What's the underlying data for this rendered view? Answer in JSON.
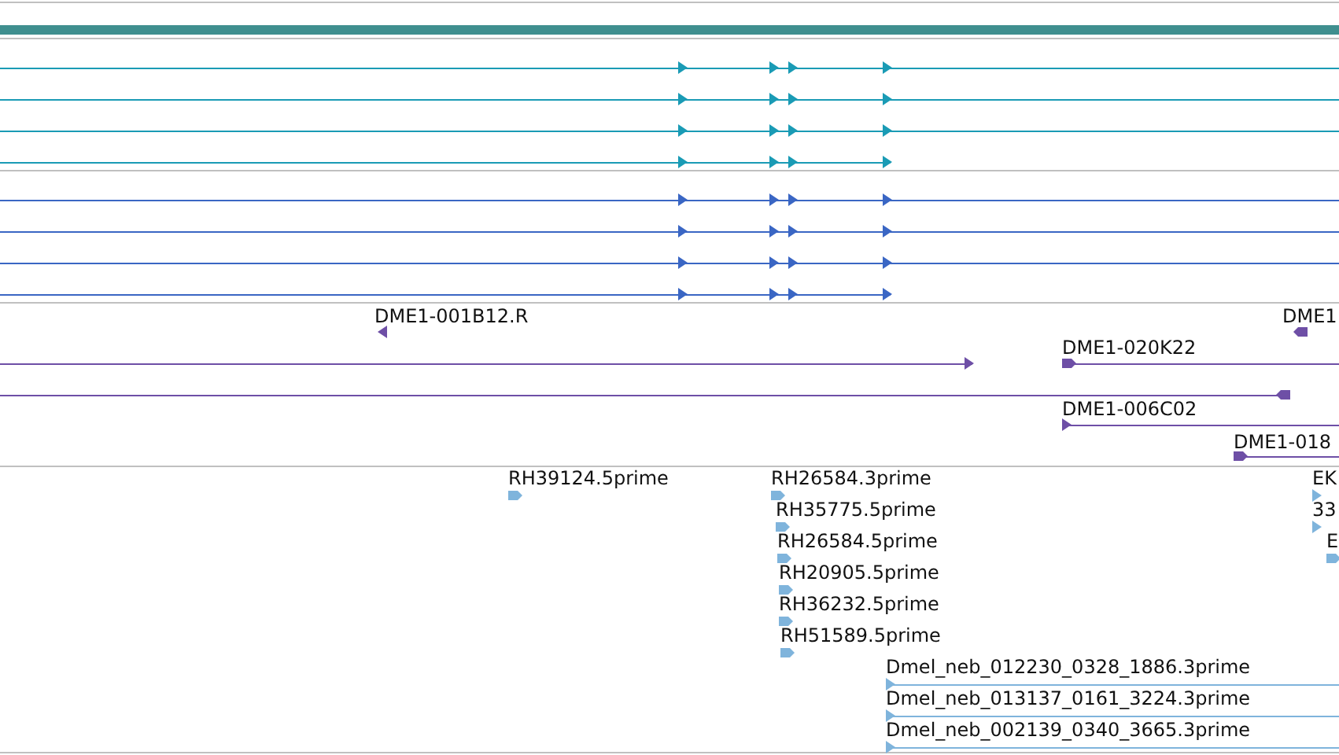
{
  "tracks": [
    {
      "kind": "bar",
      "color": "#3f8f8f"
    },
    {
      "kind": "transcripts",
      "color": "#1a9bb5",
      "rows": [
        {
          "reverse": false
        },
        {
          "reverse": false
        },
        {
          "reverse": false
        },
        {
          "reverse": false
        }
      ]
    },
    {
      "kind": "transcripts",
      "color": "#3a66c4",
      "rows": [
        {
          "reverse": false
        },
        {
          "reverse": false
        },
        {
          "reverse": false
        },
        {
          "reverse": false
        }
      ]
    },
    {
      "kind": "features",
      "color": "#6e4fa6",
      "features": [
        {
          "label": "DME1-001B12.R",
          "reverse": true
        },
        {
          "label": "DME1",
          "reverse": true
        },
        {
          "reverse": false
        },
        {
          "label": "DME1-020K22",
          "reverse": false
        },
        {
          "reverse": true
        },
        {
          "label": "DME1-006C02",
          "reverse": false
        },
        {
          "label": "DME1-018",
          "reverse": false
        }
      ]
    },
    {
      "kind": "features",
      "color": "#7fb4dc",
      "features": [
        {
          "label": "RH39124.5prime",
          "reverse": false
        },
        {
          "label": "RH26584.3prime",
          "reverse": false
        },
        {
          "label": "RH35775.5prime",
          "reverse": false
        },
        {
          "label": "RH26584.5prime",
          "reverse": false
        },
        {
          "label": "RH20905.5prime",
          "reverse": false
        },
        {
          "label": "RH36232.5prime",
          "reverse": false
        },
        {
          "label": "RH51589.5prime",
          "reverse": false
        },
        {
          "label": "Dmel_neb_012230_0328_1886.3prime",
          "reverse": false
        },
        {
          "label": "Dmel_neb_013137_0161_3224.3prime",
          "reverse": false
        },
        {
          "label": "Dmel_neb_002139_0340_3665.3prime",
          "reverse": false
        },
        {
          "label": "EK",
          "reverse": false
        },
        {
          "label": "33",
          "reverse": false
        },
        {
          "label": "E",
          "reverse": false
        }
      ]
    }
  ]
}
